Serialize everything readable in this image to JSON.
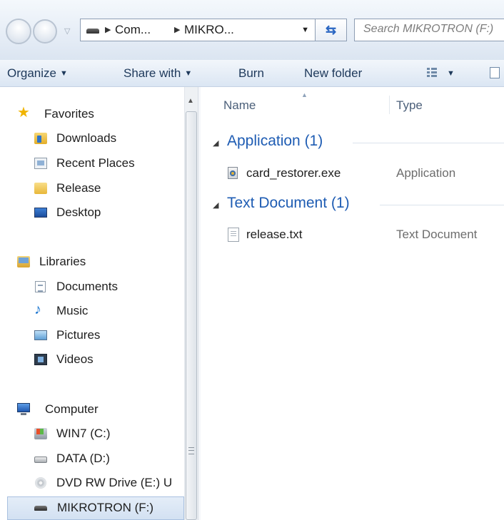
{
  "address_bar": {
    "crumbs": [
      "Com...",
      "MIKRO..."
    ],
    "search_placeholder": "Search MIKROTRON (F:)"
  },
  "toolbar": {
    "organize": "Organize",
    "share_with": "Share with",
    "burn": "Burn",
    "new_folder": "New folder"
  },
  "nav": {
    "favorites": {
      "label": "Favorites",
      "items": [
        "Downloads",
        "Recent Places",
        "Release",
        "Desktop"
      ]
    },
    "libraries": {
      "label": "Libraries",
      "items": [
        "Documents",
        "Music",
        "Pictures",
        "Videos"
      ]
    },
    "computer": {
      "label": "Computer",
      "items": [
        "WIN7 (C:)",
        "DATA (D:)",
        "DVD RW Drive (E:) U",
        "MIKROTRON (F:)"
      ],
      "selected": "MIKROTRON (F:)"
    }
  },
  "columns": {
    "name": "Name",
    "type": "Type"
  },
  "groups": [
    {
      "label": "Application (1)",
      "files": [
        {
          "name": "card_restorer.exe",
          "type": "Application"
        }
      ]
    },
    {
      "label": "Text Document (1)",
      "files": [
        {
          "name": "release.txt",
          "type": "Text Document"
        }
      ]
    }
  ],
  "icons": {
    "favorites": "star-icon",
    "downloads": "downloads-folder-icon",
    "recent_places": "recent-places-icon",
    "release": "folder-icon",
    "desktop": "desktop-icon",
    "libraries": "libraries-icon",
    "documents": "documents-icon",
    "music": "music-icon",
    "pictures": "pictures-icon",
    "videos": "videos-icon",
    "computer": "computer-icon",
    "win7": "windows-drive-icon",
    "data": "hard-drive-icon",
    "dvd": "dvd-drive-icon",
    "mikrotron": "usb-drive-icon"
  },
  "colors": {
    "group_header": "#1e5cb3",
    "toolbar_text": "#1e395b",
    "selection": "#d3e1f2"
  }
}
